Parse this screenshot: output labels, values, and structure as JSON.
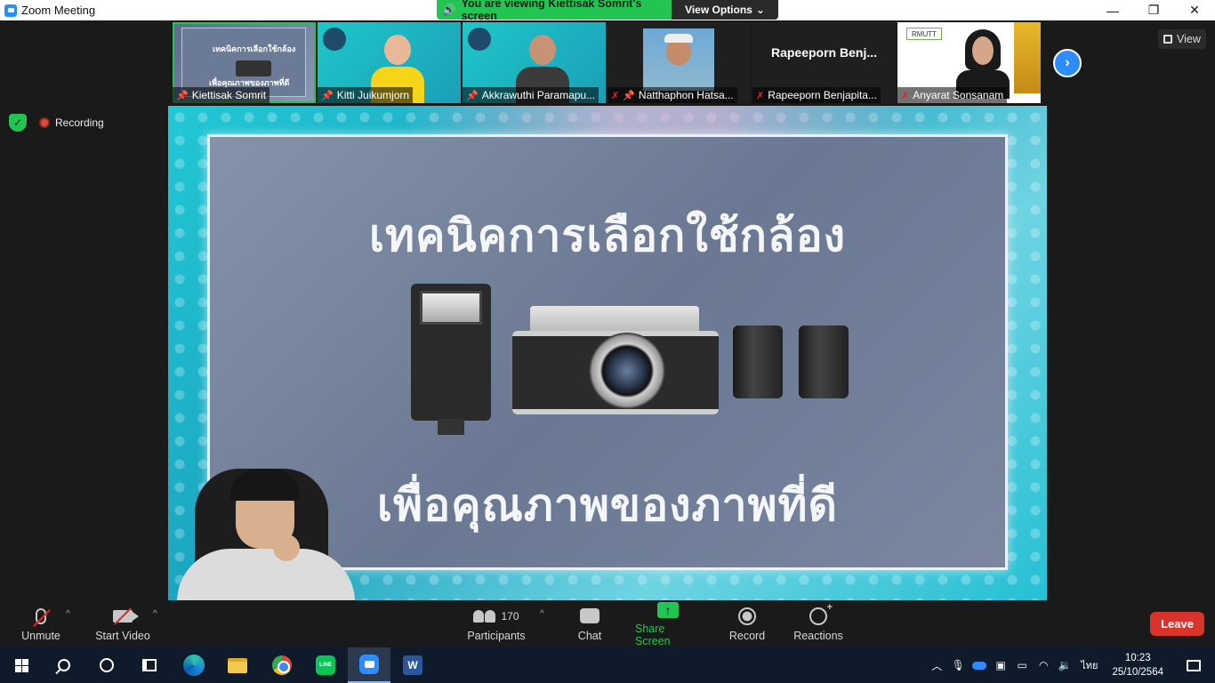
{
  "window": {
    "title": "Zoom Meeting",
    "controls": [
      "—",
      "❐",
      "✕"
    ]
  },
  "banner": {
    "viewing": "You are viewing Kiettisak Somrit's screen",
    "options": "View Options",
    "options_caret": "⌄"
  },
  "participants_strip": [
    {
      "name": "Kiettisak Somrit",
      "muted": false,
      "pinned": true
    },
    {
      "name": "Kitti Juikumjorn",
      "muted": false,
      "pinned": true
    },
    {
      "name": "Akkrawuthi Paramapu...",
      "muted": false,
      "pinned": true
    },
    {
      "name": "Natthaphon Hatsa...",
      "muted": true,
      "pinned": true
    },
    {
      "name": "Rapeeporn Benjapita...",
      "muted": true,
      "pinned": false,
      "card_name": "Rapeeporn   Benj..."
    },
    {
      "name": "Anyarat Sonsanam",
      "muted": true,
      "pinned": false
    }
  ],
  "thumb_slide_text": "เทคนิคการเลือกใช้กล้อง",
  "thumb_slide_subtext": "เพื่อคุณภาพของภาพที่ดี",
  "rmutt_logo": "RMUTT",
  "view_button": "View",
  "recording_label": "Recording",
  "slide": {
    "headline": "เทคนิคการเลือกใช้กล้อง",
    "subline": "เพื่อคุณภาพของภาพที่ดี"
  },
  "toolbar": {
    "unmute": "Unmute",
    "start_video": "Start Video",
    "participants": "Participants",
    "participant_count": "170",
    "chat": "Chat",
    "share_screen": "Share Screen",
    "record": "Record",
    "reactions": "Reactions",
    "leave": "Leave",
    "caret": "^"
  },
  "taskbar": {
    "line_label": "LINE",
    "word_label": "W",
    "language": "ไทย",
    "time": "10:23",
    "date": "25/10/2564"
  },
  "colors": {
    "accent_green": "#23c552",
    "zoom_blue": "#2d8cff",
    "leave_red": "#d9342b"
  }
}
